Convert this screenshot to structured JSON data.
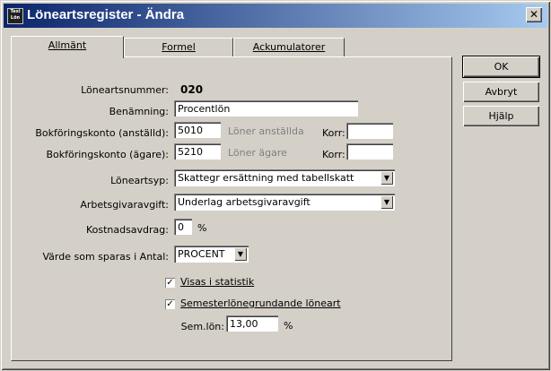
{
  "window": {
    "title": "Löneartsregister - Ändra",
    "icon_text_top": "Texi",
    "icon_text_bottom": "Lön",
    "close_glyph": "✕"
  },
  "tabs": [
    {
      "label": "Allmänt"
    },
    {
      "label": "Formel"
    },
    {
      "label": "Ackumulatorer"
    }
  ],
  "buttons": {
    "ok": "OK",
    "cancel": "Avbryt",
    "help": "Hjälp"
  },
  "form": {
    "loneartsnummer_label": "Löneartsnummer:",
    "loneartsnummer_value": "020",
    "benamning_label": "Benämning:",
    "benamning_value": "Procentlön",
    "bokf_anstalld_label": "Bokföringskonto (anställd):",
    "bokf_anstalld_value": "5010",
    "bokf_anstalld_desc": "Löner anställda",
    "bokf_agare_label": "Bokföringskonto (ägare):",
    "bokf_agare_value": "5210",
    "bokf_agare_desc": "Löner ägare",
    "korr_label": "Korr:",
    "korr1_value": "",
    "korr2_value": "",
    "loneartsyp_label": "Löneartsyp:",
    "loneartsyp_value": "Skattegr ersättning med tabellskatt",
    "arbetsgivaravgift_label": "Arbetsgivaravgift:",
    "arbetsgivaravgift_value": "Underlag arbetsgivaravgift",
    "kostnadsavdrag_label": "Kostnadsavdrag:",
    "kostnadsavdrag_value": "0",
    "percent": "%",
    "varde_label": "Värde som sparas i Antal:",
    "varde_value": "PROCENT",
    "visas_label": "Visas i statistik",
    "visas_checked": "✓",
    "semester_label": "Semesterlönegrundande löneart",
    "semester_checked": "✓",
    "semlon_label": "Sem.lön:",
    "semlon_value": "13,00"
  }
}
